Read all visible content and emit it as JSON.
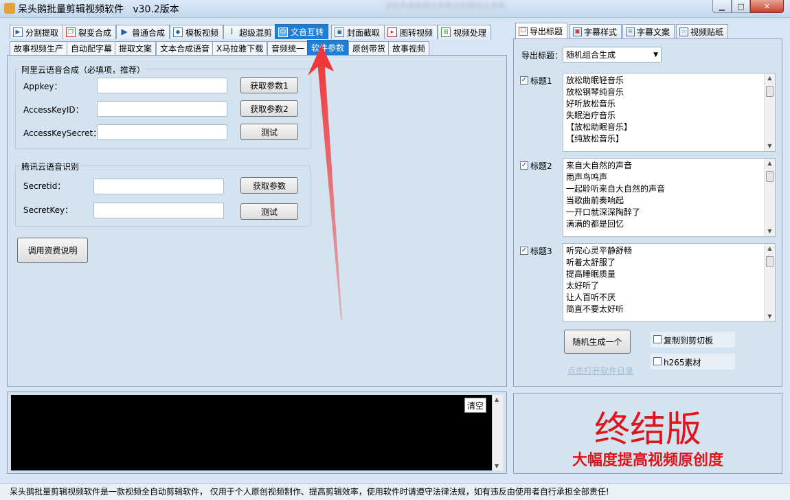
{
  "window": {
    "title": "呆头鹅批量剪辑视频软件   v30.2版本",
    "blurred_text": "该软件模板融合阿里云和腾讯云参数"
  },
  "main_tabs": [
    {
      "label": "分割提取",
      "icon": "split-icon"
    },
    {
      "label": "裂变合成",
      "icon": "fission-icon"
    },
    {
      "label": "普通合成",
      "icon": "play-icon"
    },
    {
      "label": "模板视频",
      "icon": "template-icon"
    },
    {
      "label": "超级混剪",
      "icon": "audio-wave-icon"
    },
    {
      "label": "文音互转",
      "icon": "speech-icon"
    },
    {
      "label": "封面截取",
      "icon": "image-icon"
    },
    {
      "label": "图转视频",
      "icon": "photo-video-icon"
    },
    {
      "label": "视频处理",
      "icon": "video-process-icon"
    }
  ],
  "sub_tabs": [
    "故事视频生产",
    "自动配字幕",
    "提取文案",
    "文本合成语音",
    "X马拉雅下载",
    "音频统一",
    "软件参数",
    "原创带货",
    "故事视频"
  ],
  "aliyun": {
    "legend": "阿里云语音合成（必填项，推荐）",
    "appkey_label": "Appkey：",
    "accesskeyid_label": "AccessKeyID：",
    "accesskeysecret_label": "AccessKeySecret：",
    "appkey_value": "",
    "accesskeyid_value": "",
    "accesskeysecret_value": "",
    "get_params1": "获取参数1",
    "get_params2": "获取参数2",
    "test": "测试"
  },
  "tencent": {
    "legend": "腾讯云语音识别",
    "secretid_label": "Secretid：",
    "secretkey_label": "SecretKey：",
    "secretid_value": "",
    "secretkey_value": "",
    "get_params": "获取参数",
    "test": "测试"
  },
  "fee_button": "调用资费说明",
  "right_tabs": [
    {
      "label": "导出标题",
      "icon": "export-icon"
    },
    {
      "label": "字幕样式",
      "icon": "subtitle-style-icon"
    },
    {
      "label": "字幕文案",
      "icon": "subtitle-text-icon"
    },
    {
      "label": "视频贴纸",
      "icon": "sticker-icon"
    }
  ],
  "export": {
    "label": "导出标题：",
    "selected": "随机组合生成"
  },
  "titles": [
    {
      "label": "标题1",
      "checked": true,
      "lines": [
        "放松助眠轻音乐",
        "放松钢琴纯音乐",
        "好听放松音乐",
        "失眠治疗音乐",
        "【放松助眠音乐】",
        "【纯放松音乐】"
      ]
    },
    {
      "label": "标题2",
      "checked": true,
      "lines": [
        "来自大自然的声音",
        "雨声鸟鸣声",
        "一起聆听来自大自然的声音",
        "当歌曲前奏响起",
        "一开口就深深陶醉了",
        "满满的都是回忆"
      ]
    },
    {
      "label": "标题3",
      "checked": true,
      "lines": [
        "听完心灵平静舒畅",
        "听着太舒服了",
        "提高睡眠质量",
        "太好听了",
        "让人百听不厌",
        "简直不要太好听"
      ]
    }
  ],
  "random_button": "随机生成一个",
  "copy_clipboard": {
    "label": "复制到剪切板",
    "checked": false
  },
  "h265": {
    "label": "h265素材",
    "checked": false
  },
  "open_dir_link": "点击打开软件目录",
  "console": {
    "clear_label": "清空"
  },
  "promo": {
    "title": "终结版",
    "subtitle": "大幅度提高视频原创度"
  },
  "status": "呆头鹅批量剪辑视频软件是一款视频全自动剪辑软件，  仅用于个人原创视频制作、提高剪辑效率，使用软件时请遵守法律法规，如有违反由使用者自行承担全部责任!",
  "colors": {
    "accent": "#1e7fd8",
    "promo_red": "#e0151b",
    "annotation_arrow": "#f0383a"
  }
}
